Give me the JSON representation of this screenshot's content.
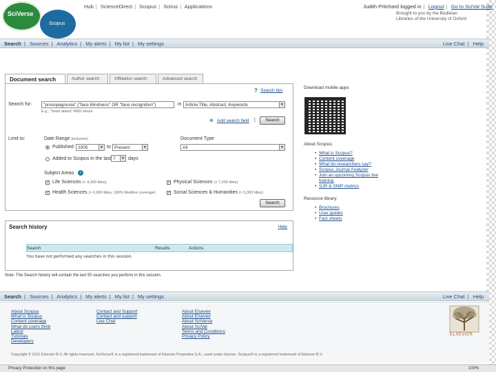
{
  "header": {
    "logo_sciverse": "SciVerse",
    "logo_scopus": "Scopus",
    "topnav": [
      "Hub",
      "ScienceDirect",
      "Scopus",
      "Scirus",
      "Applications"
    ],
    "user": "Judith Pritchard logged in",
    "logout": "Logout",
    "go_to": "Go to SciVal Suite",
    "access_text": "Brought to you by the Bodleian Libraries of the University of Oxford"
  },
  "navbar": {
    "items": [
      "Search",
      "Sources",
      "Analytics",
      "My alerts",
      "My list",
      "My settings"
    ],
    "right": [
      "Live Chat",
      "Help"
    ]
  },
  "search": {
    "tabs": [
      "Document search",
      "Author search",
      "Affiliation search",
      "Advanced search"
    ],
    "search_tips": "Search tips",
    "search_for_label": "Search for:",
    "query_value": "\"prosopagnosia\" (\"face blindness\" OR \"face recognition\")",
    "query_example": "E.g., \"heart attack\" AND stress",
    "field_in": "in",
    "field_value": "Article Title, Abstract, Keywords",
    "add_field": "Add search field",
    "search_button": "Search",
    "limit_to": "Limit to:",
    "date_range_label": "Date Range",
    "date_range_note": "(inclusive)",
    "published_label": "Published",
    "year_from": "2005",
    "to_label": "to",
    "year_to": "Present",
    "added_label": "Added to Scopus in the last",
    "added_days": "7",
    "days_label": "days",
    "doc_type_label": "Document Type",
    "doc_type_value": "All",
    "subject_areas_label": "Subject Areas",
    "subjects": [
      {
        "name": "Life Sciences",
        "count": "(> 4,300 titles)"
      },
      {
        "name": "Physical Sciences",
        "count": "(> 7,200 titles)"
      },
      {
        "name": "Health Sciences",
        "count": "(> 6,800 titles, 100% Medline coverage)"
      },
      {
        "name": "Social Sciences & Humanities",
        "count": "(> 5,300 titles)"
      }
    ],
    "search_button_2": "Search"
  },
  "history": {
    "title": "Search history",
    "help": "Help",
    "col_search": "Search",
    "col_results": "Results",
    "col_actions": "Actions",
    "empty_text": "You have not performed any searches in this session.",
    "note": "Note: The Search history will contain the last 50 searches you perform in this session."
  },
  "right": {
    "download_mobile": "Download mobile apps",
    "about_header": "About Scopus:",
    "about_links": [
      "What is Scopus?",
      "Content coverage",
      "What do researchers say?",
      "Scopus Journal Analyzer",
      "Join an upcoming Scopus live training",
      "SJR & SNIP metrics"
    ],
    "resource_header": "Resource library:",
    "resource_links": [
      "Brochures",
      "User guides",
      "Fact sheets"
    ]
  },
  "footer": {
    "col1": [
      "About Scopus",
      "What is Scopus",
      "Content coverage",
      "What do users think",
      "Latest",
      "Tutorials",
      "Developers"
    ],
    "col2": [
      "Contact and Support",
      "Contact and support",
      "Live Chat"
    ],
    "col3": [
      "About Elsevier",
      "About Elsevier",
      "About SciVerse",
      "About SciVal",
      "Terms and Conditions",
      "Privacy Policy"
    ],
    "elsevier_logo": "ELSEVIER",
    "copyright": "Copyright © 2011 Elsevier B.V. All rights reserved. SciVerse® is a registered trademark of Elsevier Properties S.A., used under license. Scopus® is a registered trademark of Elsevier B.V."
  },
  "statusbar": {
    "left": "Privacy Protection on this page",
    "zoom": "100%"
  }
}
